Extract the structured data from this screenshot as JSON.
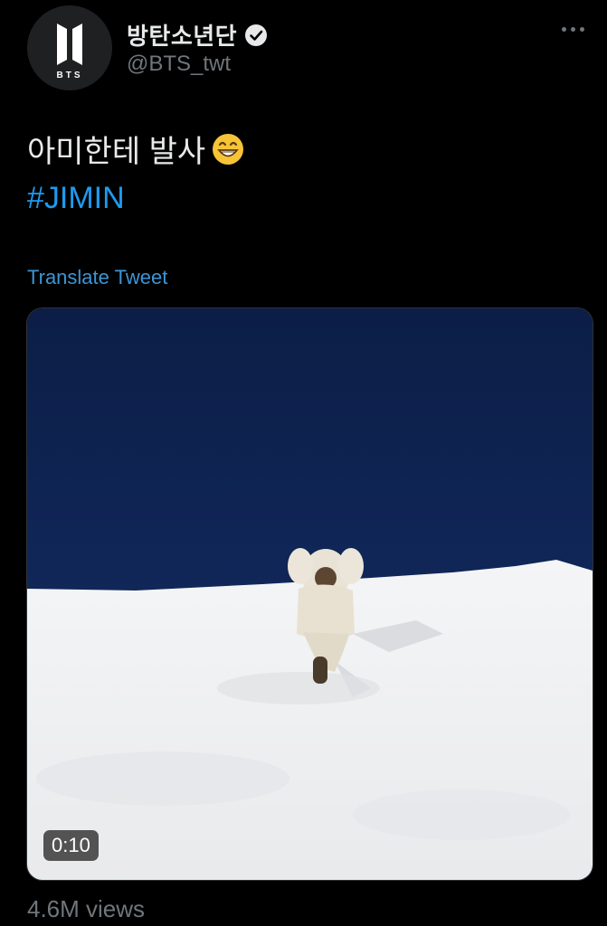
{
  "author": {
    "avatar_icon": "bts-logo-icon",
    "avatar_text": "BTS",
    "display_name": "방탄소년단",
    "verified_icon": "verified-badge-icon",
    "handle": "@BTS_twt"
  },
  "menu_icon": "more-options-icon",
  "tweet": {
    "text": "아미한테 발사",
    "emoji_icon": "grinning-face-emoji",
    "hashtag": "#JIMIN",
    "translate_link": "Translate Tweet"
  },
  "media": {
    "type": "video",
    "duration": "0:10",
    "colors": {
      "sky": "#0f2350",
      "snow": "#f2f3f4"
    }
  },
  "views": "4.6M views",
  "colors": {
    "background": "#000000",
    "link": "#1d9bf0",
    "muted": "#71767b"
  }
}
